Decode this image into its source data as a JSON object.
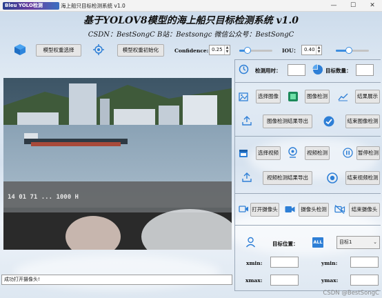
{
  "window": {
    "logo_text": "Bleu YOLO检测",
    "title": "海上船只目标检测系统 v1.0",
    "minimize": "—",
    "maximize": "☐",
    "close": "✕"
  },
  "header": {
    "title": "基于YOLOV8模型的海上船只目标检测系统 v1.0",
    "subtitle": "CSDN：BestSongC   B站：Bestsongc   微信公众号：BestSongC"
  },
  "toolbar": {
    "model_select_label": "模型权重选择",
    "model_init_label": "模型权重初始化",
    "confidence_label": "Confidence:",
    "confidence_value": "0.25",
    "iou_label": "IOU：",
    "iou_value": "0.40",
    "confidence_slider_level": 0.25,
    "iou_slider_level": 0.4
  },
  "stats": {
    "time_label": "检测用时：",
    "count_label": "目标数量："
  },
  "image_section": {
    "select_label": "选择图像",
    "detect_label": "图像检测",
    "result_label": "结果展示",
    "export_label": "图像检测结果导出",
    "stop_label": "结束图像检测"
  },
  "video_section": {
    "select_label": "选择视频",
    "detect_label": "视频检测",
    "pause_label": "暂停检测",
    "export_label": "视频检测结果导出",
    "stop_label": "结束视频检测"
  },
  "camera_section": {
    "open_label": "打开摄像头",
    "detect_label": "摄像头检测",
    "stop_label": "结束摄像头"
  },
  "position": {
    "label": "目标位置：",
    "all_badge": "ALL",
    "target_option": "目标1",
    "xmin_label": "xmin:",
    "ymin_label": "ymin:",
    "xmax_label": "xmax:",
    "ymax_label": "ymax:"
  },
  "video_overlay": {
    "timestamp_text": "14 01 71 ... 1000 H"
  },
  "status_bar": {
    "message": "成功打开摄像头!"
  },
  "watermark": "CSDN @BestSongC",
  "colors": {
    "accent": "#2e7fd6",
    "slider": "#3b8de0"
  }
}
